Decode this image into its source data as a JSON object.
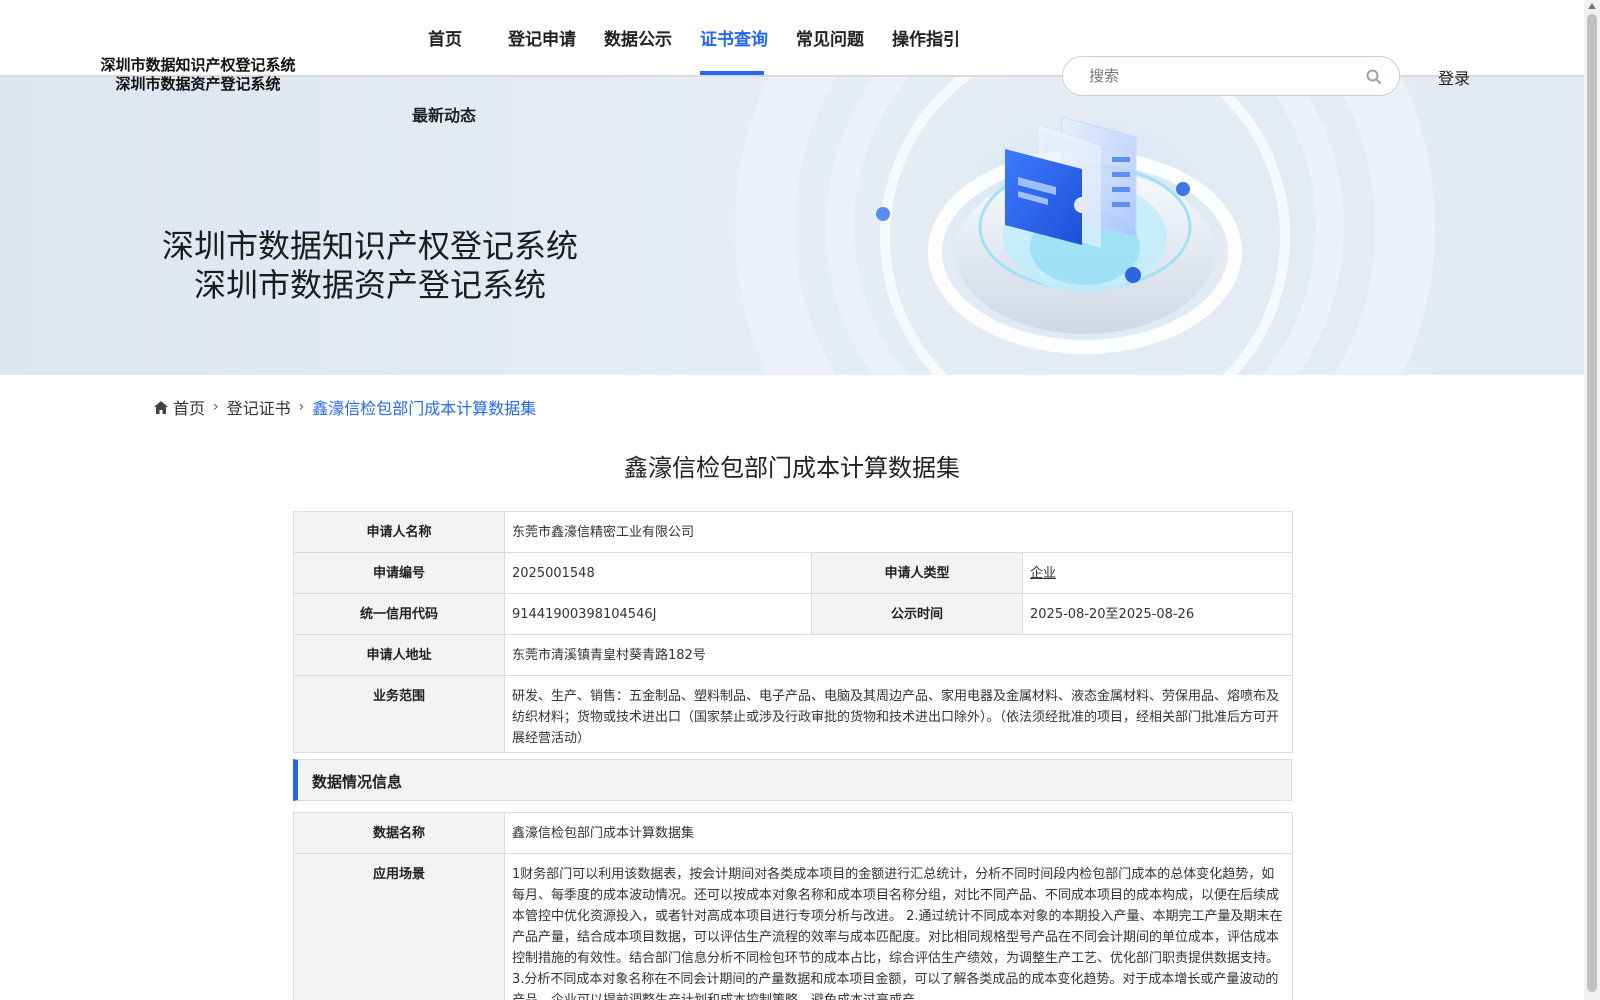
{
  "header": {
    "logo_line1": "深圳市数据知识产权登记系统",
    "logo_line2": "深圳市数据资产登记系统",
    "nav": [
      {
        "label": "首页"
      },
      {
        "label": "登记申请"
      },
      {
        "label": "数据公示"
      },
      {
        "label": "证书查询",
        "active": true
      },
      {
        "label": "常见问题"
      },
      {
        "label": "操作指引"
      },
      {
        "label": "最新动态"
      }
    ],
    "search_placeholder": "搜索",
    "login_label": "登录",
    "accent_color": "#2468f2"
  },
  "banner": {
    "title_line1": "深圳市数据知识产权登记系统",
    "title_line2": "深圳市数据资产登记系统"
  },
  "breadcrumb": {
    "home": "首页",
    "level2": "登记证书",
    "current": "鑫濠信检包部门成本计算数据集"
  },
  "page_title": "鑫濠信检包部门成本计算数据集",
  "applicant": {
    "name_label": "申请人名称",
    "name_value": "东莞市鑫濠信精密工业有限公司",
    "number_label": "申请编号",
    "number_value": "2025001548",
    "type_label": "申请人类型",
    "type_value": "企业",
    "credit_label": "统一信用代码",
    "credit_value": "91441900398104546J",
    "publicity_label": "公示时间",
    "publicity_value": "2025-08-20至2025-08-26",
    "address_label": "申请人地址",
    "address_value": "东莞市清溪镇青皇村葵青路182号",
    "scope_label": "业务范围",
    "scope_value": "研发、生产、销售：五金制品、塑料制品、电子产品、电脑及其周边产品、家用电器及金属材料、液态金属材料、劳保用品、熔喷布及纺织材料；货物或技术进出口（国家禁止或涉及行政审批的货物和技术进出口除外）。（依法须经批准的项目，经相关部门批准后方可开展经营活动）"
  },
  "data_section": {
    "heading": "数据情况信息",
    "data_name_label": "数据名称",
    "data_name_value": "鑫濠信检包部门成本计算数据集",
    "scenario_label": "应用场景",
    "scenario_value": "1财务部门可以利用该数据表，按会计期间对各类成本项目的金额进行汇总统计，分析不同时间段内检包部门成本的总体变化趋势，如每月、每季度的成本波动情况。还可以按成本对象名称和成本项目名称分组，对比不同产品、不同成本项目的成本构成，以便在后续成本管控中优化资源投入，或者针对高成本项目进行专项分析与改进。 2.通过统计不同成本对象的本期投入产量、本期完工产量及期末在产品产量，结合成本项目数据，可以评估生产流程的效率与成本匹配度。对比相同规格型号产品在不同会计期间的单位成本，评估成本控制措施的有效性。结合部门信息分析不同检包环节的成本占比，综合评估生产绩效，为调整生产工艺、优化部门职责提供数据支持。 3.分析不同成本对象名称在不同会计期间的产量数据和成本项目金额，可以了解各类成品的成本变化趋势。对于成本增长或产量波动的产品，企业可以提前调整生产计划和成本控制策略，避免成本过高或产"
  }
}
